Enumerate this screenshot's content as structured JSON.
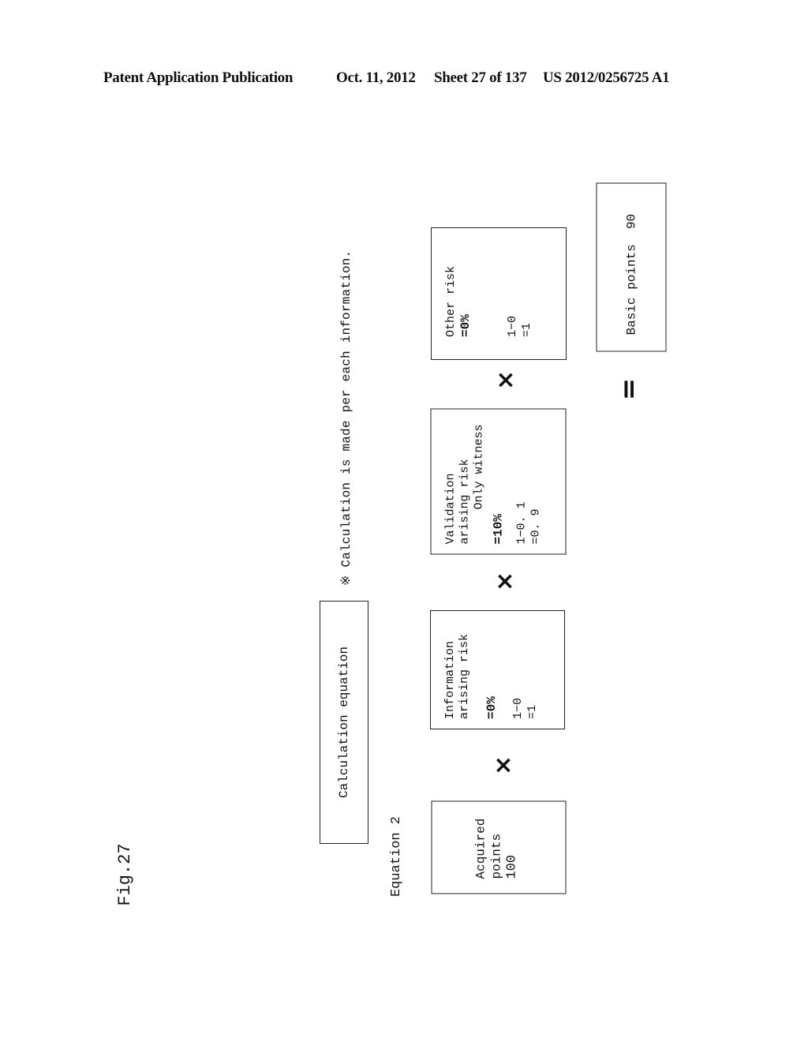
{
  "header": {
    "publication": "Patent Application Publication",
    "date": "Oct. 11, 2012",
    "sheet": "Sheet 27 of 137",
    "number": "US 2012/0256725 A1"
  },
  "figure": {
    "label": "Fig.27",
    "title_box": "Calculation equation",
    "note": "※ Calculation is made per each information.",
    "equation_label": "Equation 2",
    "terms": [
      {
        "name": "acquired-points",
        "lines": [
          "Acquired",
          "points",
          "100"
        ]
      },
      {
        "name": "information-arising-risk",
        "title_lines": [
          "Information",
          "arising risk"
        ],
        "percent": "=0%",
        "calc_lines": [
          "1−0",
          "=1"
        ]
      },
      {
        "name": "validation-arising-risk",
        "title_lines": [
          "Validation",
          "arising risk"
        ],
        "subtitle": "Only witness",
        "percent": "=10%",
        "calc_lines": [
          "1−0. 1",
          "=0. 9"
        ]
      },
      {
        "name": "other-risk",
        "title_lines": [
          "Other risk"
        ],
        "percent": "=0%",
        "calc_lines": [
          "1−0",
          "=1"
        ]
      }
    ],
    "operators": [
      "×",
      "×",
      "×",
      "="
    ],
    "result": "Basic points  90"
  }
}
